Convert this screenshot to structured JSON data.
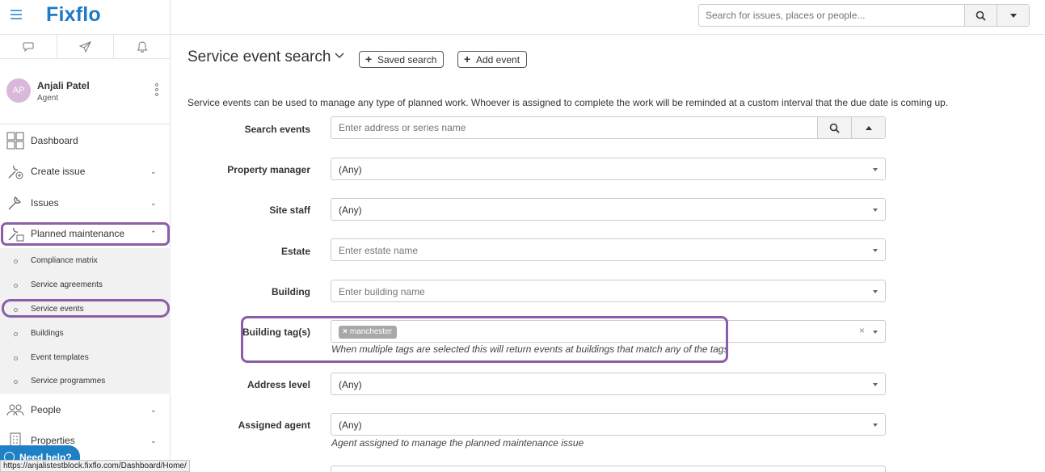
{
  "brand": {
    "logo": "Fixflo"
  },
  "global_search": {
    "placeholder": "Search for issues, places or people..."
  },
  "user": {
    "initials": "AP",
    "name": "Anjali Patel",
    "role": "Agent"
  },
  "nav": {
    "dashboard": "Dashboard",
    "create_issue": "Create issue",
    "issues": "Issues",
    "planned_maintenance": "Planned maintenance",
    "people": "People",
    "properties": "Properties"
  },
  "subnav": [
    "Compliance matrix",
    "Service agreements",
    "Service events",
    "Buildings",
    "Event templates",
    "Service programmes"
  ],
  "need_help": "Need help?",
  "status_url": "https://anjalistestblock.fixflo.com/Dashboard/Home/",
  "page": {
    "title": "Service event search",
    "saved_search": "Saved search",
    "add_event": "Add event",
    "intro": "Service events can be used to manage any type of planned work. Whoever is assigned to complete the work will be reminded at a custom interval that the due date is coming up."
  },
  "form": {
    "search_events": {
      "label": "Search events",
      "placeholder": "Enter address or series name"
    },
    "property_manager": {
      "label": "Property manager",
      "value": "(Any)"
    },
    "site_staff": {
      "label": "Site staff",
      "value": "(Any)"
    },
    "estate": {
      "label": "Estate",
      "placeholder": "Enter estate name"
    },
    "building": {
      "label": "Building",
      "placeholder": "Enter building name"
    },
    "building_tags": {
      "label": "Building tag(s)",
      "tag_remove": "×",
      "tag": "manchester",
      "clear": "×",
      "help": "When multiple tags are selected this will return events at buildings that match any of the tags"
    },
    "address_level": {
      "label": "Address level",
      "value": "(Any)"
    },
    "assigned_agent": {
      "label": "Assigned agent",
      "value": "(Any)",
      "help": "Agent assigned to manage the planned maintenance issue"
    }
  },
  "colors": {
    "brand": "#1d7ac6",
    "highlight": "#8b5ea8",
    "need_help_bg": "#1e80c5"
  }
}
